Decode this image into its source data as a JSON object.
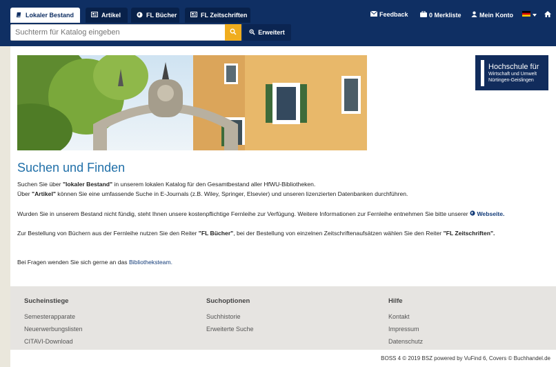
{
  "tabs": [
    {
      "label": "Lokaler Bestand",
      "icon": "book-icon"
    },
    {
      "label": "Artikel",
      "icon": "newspaper-icon"
    },
    {
      "label": "FL Bücher",
      "icon": "globe-icon"
    },
    {
      "label": "FL Zeitschriften",
      "icon": "newspaper-icon"
    }
  ],
  "search": {
    "placeholder": "Suchterm für Katalog eingeben",
    "advanced_label": "Erweitert"
  },
  "topnav": {
    "feedback": "Feedback",
    "merkliste": "0 Merkliste",
    "konto": "Mein Konto"
  },
  "logo": {
    "line1": "Hochschule für",
    "line2": "Wirtschaft und Umwelt",
    "line3": "Nürtingen-Geislingen"
  },
  "main": {
    "title": "Suchen und Finden",
    "p1_a": "Suchen Sie über ",
    "p1_b": "\"lokaler Bestand\"",
    "p1_c": " in unserem lokalen Katalog für den Gesamtbestand aller HfWU-Bibliotheken.",
    "p2_a": "Über ",
    "p2_b": "\"Artikel\"",
    "p2_c": " können Sie eine umfassende Suche in E-Journals (z.B. Wiley, Springer, Elsevier) und unseren lizenzierten Datenbanken durchführen.",
    "p3_a": "Wurden Sie in unserem Bestand nicht fündig, steht Ihnen unsere kostenpflichtige Fernleihe zur Verfügung. Weitere Informationen zur Fernleihe entnehmen Sie bitte unserer ",
    "p3_link": "Webseite.",
    "p4_a": "Zur Bestellung von Büchern aus der Fernleihe nutzen Sie den Reiter ",
    "p4_b": "\"FL Bücher\"",
    "p4_c": ", bei der Bestellung von einzelnen Zeitschriftenaufsätzen wählen Sie den Reiter ",
    "p4_d": "\"FL Zeitschriften\".",
    "p5_a": "Bei Fragen wenden Sie sich gerne an das ",
    "p5_link": "Bibliotheksteam."
  },
  "footer": {
    "col1": {
      "title": "Sucheinstiege",
      "items": [
        "Semesterapparate",
        "Neuerwerbungslisten",
        "CITAVI-Download"
      ]
    },
    "col2": {
      "title": "Suchoptionen",
      "items": [
        "Suchhistorie",
        "Erweiterte Suche"
      ]
    },
    "col3": {
      "title": "Hilfe",
      "items": [
        "Kontakt",
        "Impressum",
        "Datenschutz"
      ]
    }
  },
  "credits": "BOSS 4 © 2019 BSZ powered by VuFind 6, Covers © Buchhandel.de",
  "colors": {
    "header": "#0f2f63",
    "accent": "#f0ad1e",
    "title": "#1f6fa8"
  }
}
